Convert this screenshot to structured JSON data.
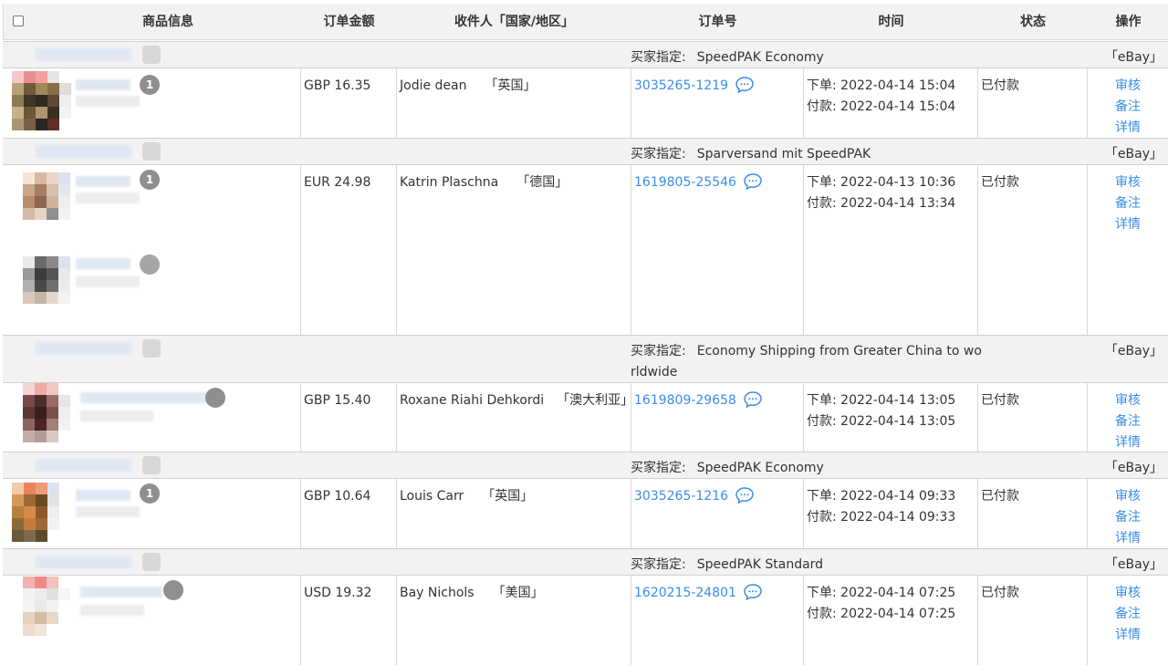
{
  "header": {
    "columns": [
      "商品信息",
      "订单金额",
      "收件人「国家/地区」",
      "订单号",
      "时间",
      "状态",
      "操作"
    ]
  },
  "labels": {
    "buyer_specified": "买家指定:",
    "ordered_prefix": "下单:",
    "paid_prefix": "付款:",
    "actions": [
      "审核",
      "备注",
      "详情"
    ]
  },
  "orders": [
    {
      "shipping": "SpeedPAK Economy",
      "platform": "「eBay」",
      "amount": "GBP 16.35",
      "recipient": "Jodie dean",
      "country": "「英国」",
      "order_no": "3035265-1219",
      "ordered": "2022-04-14 15:04",
      "paid": "2022-04-14 15:04",
      "status": "已付款",
      "item_count": "1"
    },
    {
      "shipping": "Sparversand mit SpeedPAK",
      "platform": "「eBay」",
      "amount": "EUR 24.98",
      "recipient": "Katrin Plaschna",
      "country": "「德国」",
      "order_no": "1619805-25546",
      "ordered": "2022-04-13 10:36",
      "paid": "2022-04-14 13:34",
      "status": "已付款",
      "item_count": "1"
    },
    {
      "shipping": "Economy Shipping from Greater China to worldwide",
      "platform": "「eBay」",
      "amount": "GBP 15.40",
      "recipient": "Roxane Riahi Dehkordi",
      "country": "「澳大利亚」",
      "order_no": "1619809-29658",
      "ordered": "2022-04-14 13:05",
      "paid": "2022-04-14 13:05",
      "status": "已付款",
      "item_count": ""
    },
    {
      "shipping": "SpeedPAK Economy",
      "platform": "「eBay」",
      "amount": "GBP 10.64",
      "recipient": "Louis Carr",
      "country": "「英国」",
      "order_no": "3035265-1216",
      "ordered": "2022-04-14 09:33",
      "paid": "2022-04-14 09:33",
      "status": "已付款",
      "item_count": "1"
    },
    {
      "shipping": "SpeedPAK Standard",
      "platform": "「eBay」",
      "amount": "USD 19.32",
      "recipient": "Bay Nichols",
      "country": "「美国」",
      "order_no": "1620215-24801",
      "ordered": "2022-04-14 07:25",
      "paid": "2022-04-14 07:25",
      "status": "已付款",
      "item_count": ""
    }
  ],
  "colors": {
    "link": "#3a8ee6",
    "header_bg": "#f2f2f2",
    "border": "#d9d9d9"
  },
  "icons": {
    "chat": "chat-bubble-icon"
  }
}
